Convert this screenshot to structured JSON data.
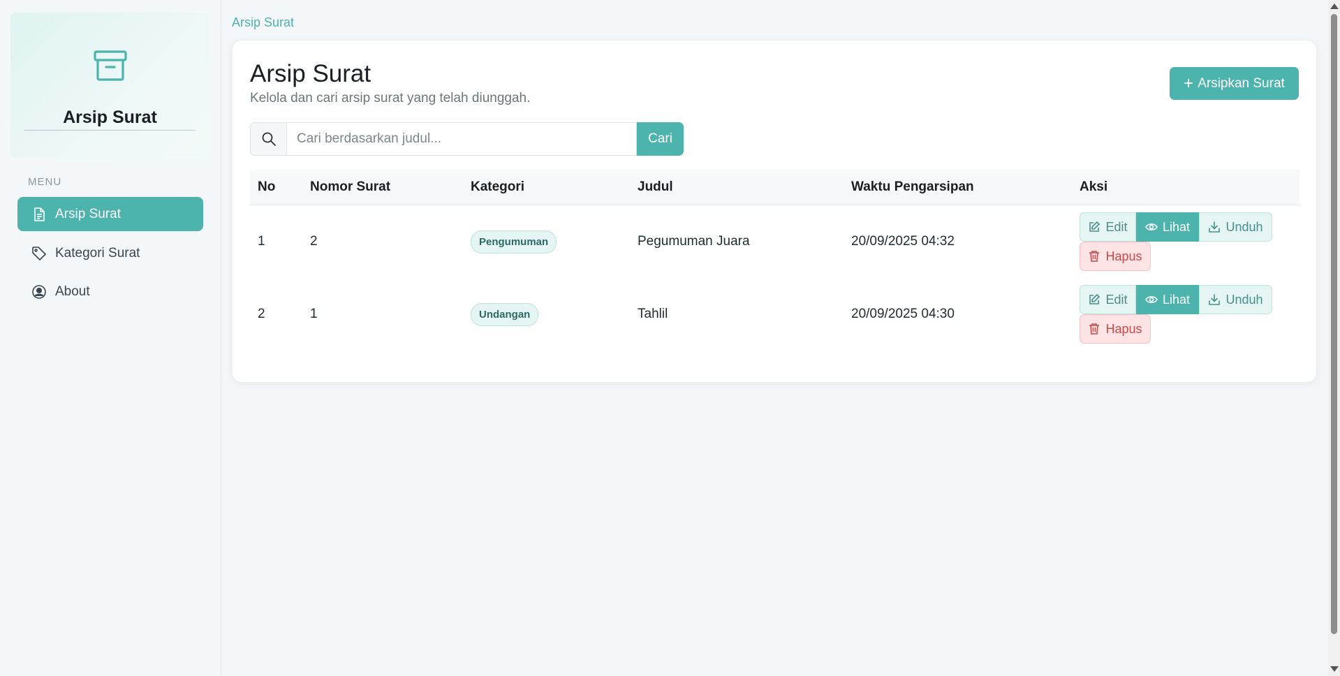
{
  "sidebar": {
    "brand_title": "Arsip Surat",
    "menu_label": "MENU",
    "items": [
      {
        "label": "Arsip Surat",
        "icon": "file-text-icon",
        "active": true
      },
      {
        "label": "Kategori Surat",
        "icon": "tag-icon",
        "active": false
      },
      {
        "label": "About",
        "icon": "user-circle-icon",
        "active": false
      }
    ]
  },
  "breadcrumb": "Arsip Surat",
  "main": {
    "title": "Arsip Surat",
    "subtitle": "Kelola dan cari arsip surat yang telah diunggah.",
    "add_button": "Arsipkan Surat",
    "search": {
      "placeholder": "Cari berdasarkan judul...",
      "value": "",
      "button": "Cari"
    },
    "table": {
      "headers": [
        "No",
        "Nomor Surat",
        "Kategori",
        "Judul",
        "Waktu Pengarsipan",
        "Aksi"
      ],
      "rows": [
        {
          "no": "1",
          "nomor": "2",
          "kategori": "Pengumuman",
          "judul": "Pegumuman Juara",
          "waktu": "20/09/2025 04:32"
        },
        {
          "no": "2",
          "nomor": "1",
          "kategori": "Undangan",
          "judul": "Tahlil",
          "waktu": "20/09/2025 04:30"
        }
      ],
      "actions": {
        "edit": "Edit",
        "lihat": "Lihat",
        "unduh": "Unduh",
        "hapus": "Hapus"
      }
    }
  },
  "colors": {
    "accent": "#4db3ad",
    "danger": "#c94b4b",
    "background": "#f4f7f9"
  }
}
